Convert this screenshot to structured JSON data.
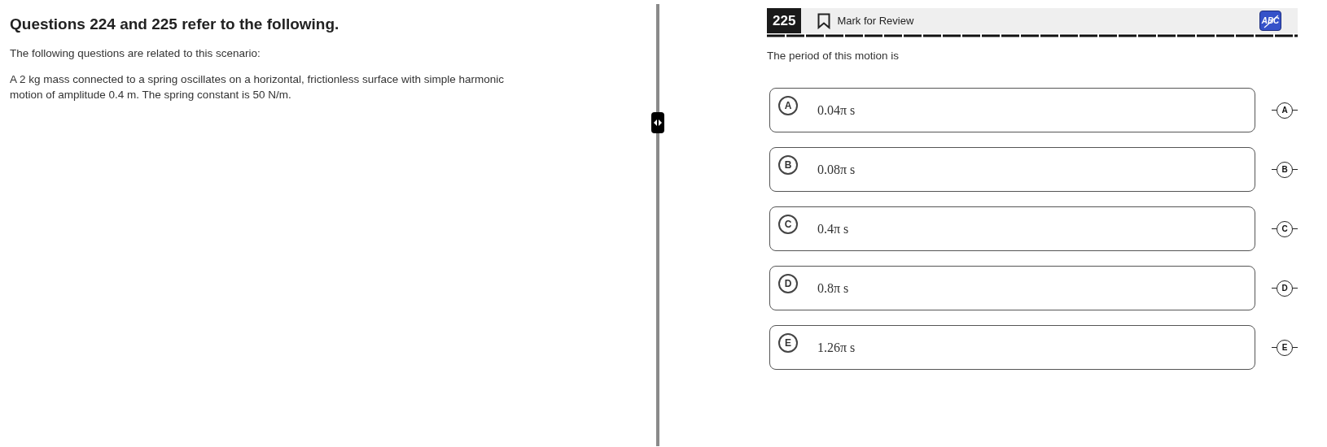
{
  "passage": {
    "heading": "Questions 224 and 225 refer to the following.",
    "intro": "The following questions are related to this scenario:",
    "body": "A 2 kg mass connected to a spring oscillates on a horizontal, frictionless surface with simple harmonic motion of amplitude 0.4 m. The spring constant is 50 N/m."
  },
  "question": {
    "number": "225",
    "mark_label": "Mark for Review",
    "marked": false,
    "strike_tool": "ABC",
    "prompt": "The period of this motion is",
    "options": [
      {
        "letter": "A",
        "answer": "0.04π s",
        "strike_letter": "A",
        "selected": false
      },
      {
        "letter": "B",
        "answer": "0.08π s",
        "strike_letter": "B",
        "selected": false
      },
      {
        "letter": "C",
        "answer": "0.4π s",
        "strike_letter": "C",
        "selected": false
      },
      {
        "letter": "D",
        "answer": "0.8π s",
        "strike_letter": "D",
        "selected": false
      },
      {
        "letter": "E",
        "answer": "1.26π s",
        "strike_letter": "E",
        "selected": false
      }
    ]
  }
}
